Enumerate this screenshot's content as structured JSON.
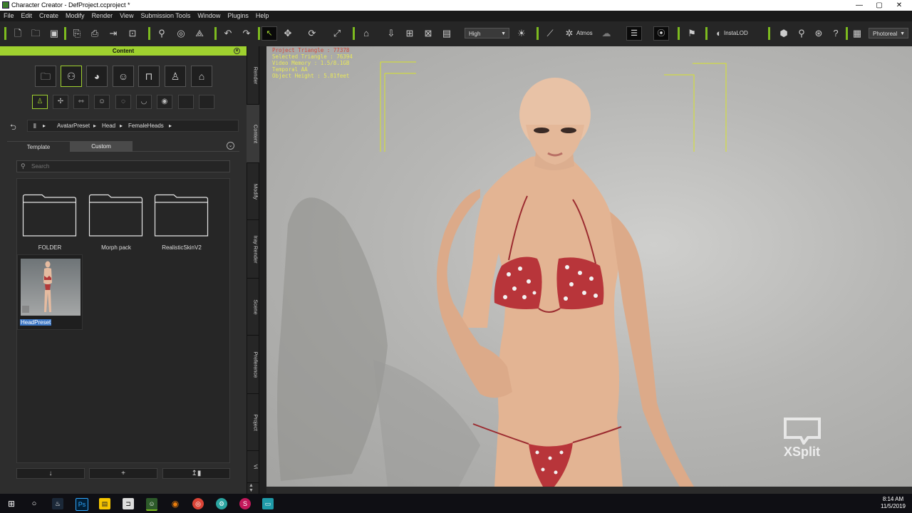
{
  "window": {
    "title": "Character Creator - DefProject.ccproject *",
    "minimize": "—",
    "maximize": "▢",
    "close": "✕"
  },
  "menu": [
    "File",
    "Edit",
    "Create",
    "Modify",
    "Render",
    "View",
    "Submission Tools",
    "Window",
    "Plugins",
    "Help"
  ],
  "toolbar": {
    "quality_select": "High",
    "atmosphere_label": "Atmos",
    "instalod_label": "InstaLOD",
    "render_mode_select": "Photoreal",
    "accent_color": "#7dbb1f"
  },
  "content_panel": {
    "title": "Content",
    "breadcrumb": [
      "AvatarPreset",
      "Head",
      "FemaleHeads"
    ],
    "tabs": [
      "Template",
      "Custom"
    ],
    "active_tab": "Custom",
    "search_placeholder": "Search",
    "folders": [
      "FOLDER",
      "Morph pack",
      "RealisticSkinV2"
    ],
    "items": [
      {
        "label": "HeadPreset",
        "selected": true
      }
    ],
    "bottom_buttons": [
      "↓",
      "+",
      "↥▮"
    ]
  },
  "side_tabs": [
    "Render",
    "Content",
    "Modify",
    "Iray Render",
    "Scene",
    "Preference",
    "Project",
    "Vi"
  ],
  "active_side_tab": "Content",
  "viewport": {
    "stats": [
      {
        "text": "Project Triangle : 77378",
        "color": "red"
      },
      {
        "text": "Selected Triangle : 76394",
        "color": "yellow"
      },
      {
        "text": "Video Memory : 1.5/8.1GB",
        "color": "yellow"
      },
      {
        "text": "Temporal AA",
        "color": "yellow"
      },
      {
        "text": "Object Height : 5.81feet",
        "color": "yellow"
      }
    ],
    "watermark": "XSplit"
  },
  "taskbar": {
    "time": "8:14 AM",
    "date": "11/5/2019"
  }
}
